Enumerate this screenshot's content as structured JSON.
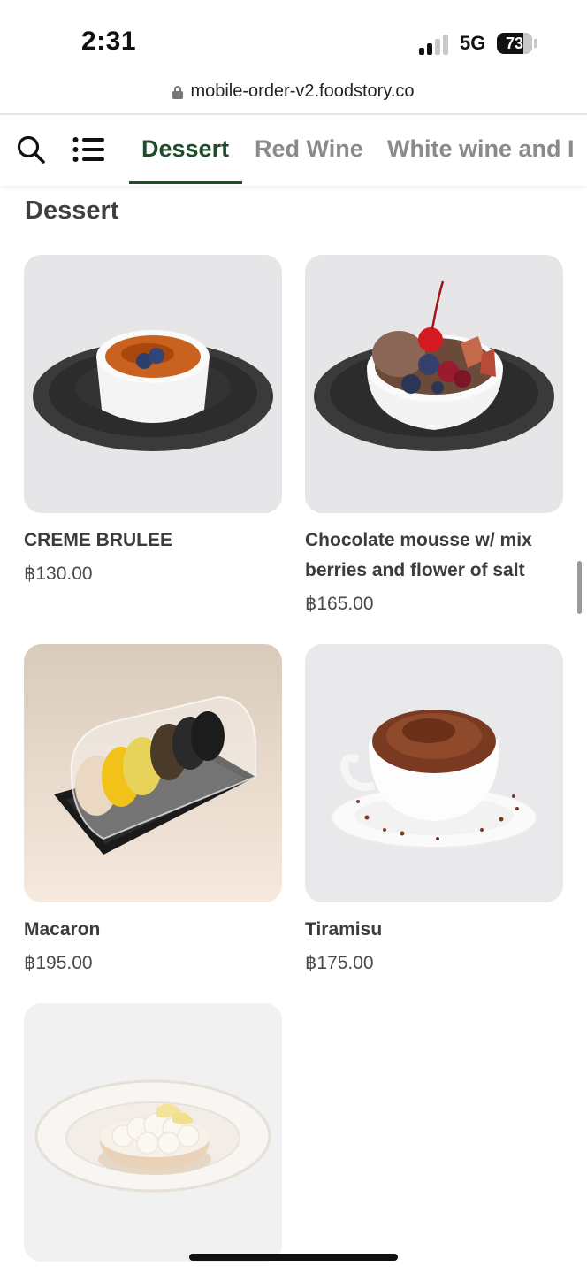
{
  "status_bar": {
    "time": "2:31",
    "network": "5G",
    "battery": "73"
  },
  "browser": {
    "url": "mobile-order-v2.foodstory.co"
  },
  "nav": {
    "tabs": [
      {
        "label": "Dessert",
        "active": true
      },
      {
        "label": "Red Wine",
        "active": false
      },
      {
        "label": "White wine and I",
        "active": false
      }
    ]
  },
  "section": {
    "title": "Dessert"
  },
  "products": [
    {
      "name": "CREME BRULEE",
      "price": "฿130.00"
    },
    {
      "name": "Chocolate mousse w/ mix berries and flower of salt",
      "price": "฿165.00"
    },
    {
      "name": "Macaron",
      "price": "฿195.00"
    },
    {
      "name": "Tiramisu",
      "price": "฿175.00"
    },
    {
      "name": "",
      "price": ""
    }
  ],
  "colors": {
    "accent": "#1f4d2b",
    "tab_inactive": "#8a8a8a"
  }
}
